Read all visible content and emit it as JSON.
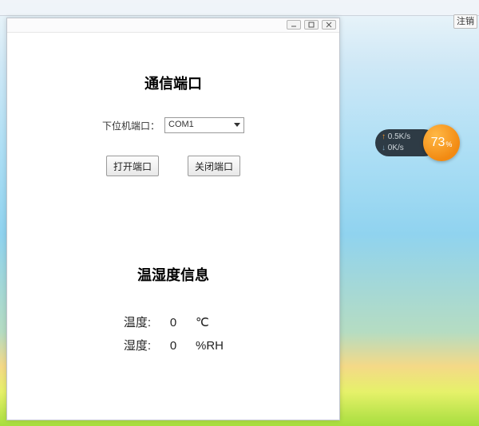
{
  "topbar": {
    "logout_label": "注销"
  },
  "window": {
    "controls": {
      "min": "minimize",
      "max": "maximize",
      "close": "close"
    }
  },
  "comm": {
    "title": "通信端口",
    "port_label": "下位机端口：",
    "port_value": "COM1",
    "open_btn": "打开端口",
    "close_btn": "关闭端口"
  },
  "sensor": {
    "title": "温湿度信息",
    "temp_label": "温度:",
    "temp_value": "0",
    "temp_unit": "℃",
    "hum_label": "湿度:",
    "hum_value": "0",
    "hum_unit": "%RH"
  },
  "net_widget": {
    "upload": "0.5K/s",
    "download": "0K/s",
    "percent": "73",
    "percent_suffix": "%"
  }
}
